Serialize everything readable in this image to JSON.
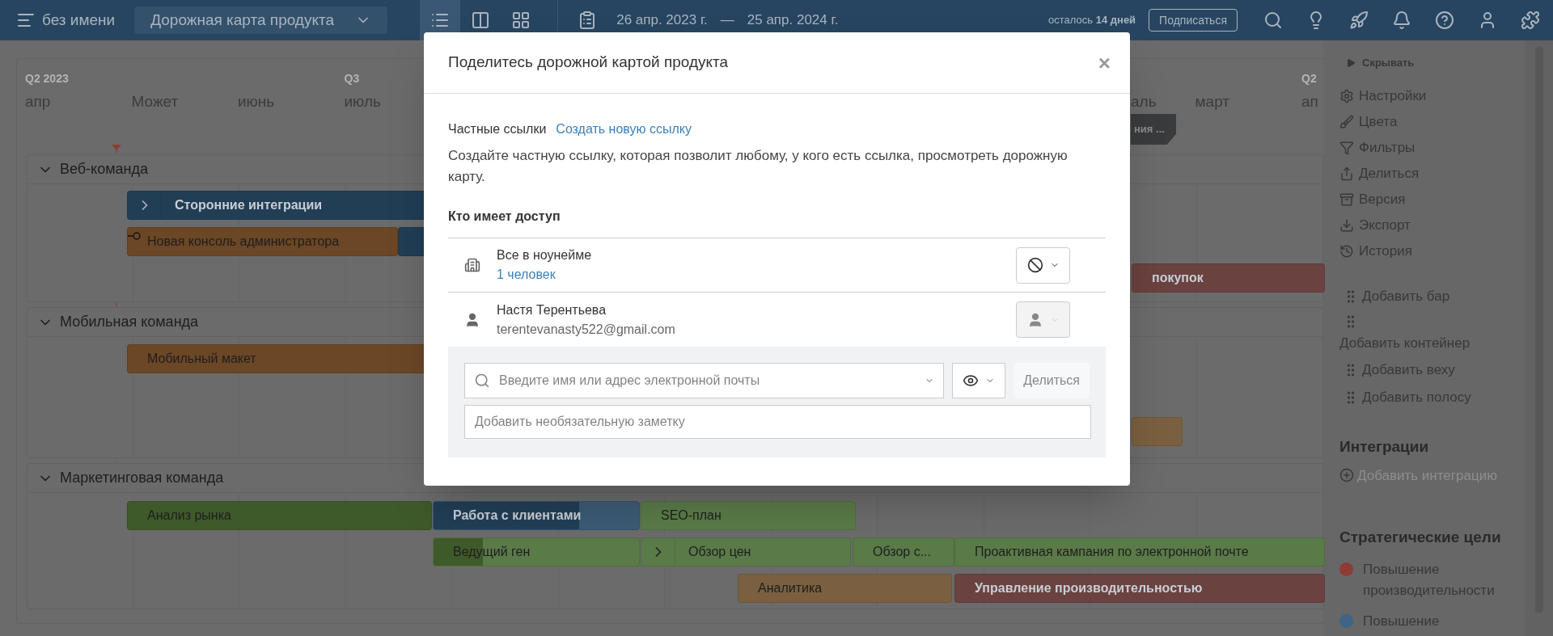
{
  "topbar": {
    "title": "без имени",
    "roadmap_select": "Дорожная карта продукта",
    "views": [
      {
        "kind": "list",
        "selected": true
      },
      {
        "kind": "columns",
        "selected": false
      },
      {
        "kind": "grid",
        "selected": false
      }
    ],
    "date_start": "26 апр. 2023 г.",
    "date_sep": "—",
    "date_end": "25 апр. 2024 г.",
    "trial": "осталось **14 дней**",
    "subscribe": "Подписаться"
  },
  "timeline": {
    "quarters": [
      "Q2 2023",
      "Q3",
      "Q2"
    ],
    "months": [
      "апр",
      "Может",
      "июнь",
      "июль",
      "аль",
      "март",
      "ап"
    ],
    "milestones": [
      {
        "label": "ния ..."
      }
    ],
    "lanes": [
      {
        "name": "Веб-команда",
        "expanded": true,
        "bars": [
          {
            "label": "Сторонние интеграции",
            "kind": "container",
            "color": "#213e55",
            "expandable": true
          },
          {
            "label": "Новая консоль администратора",
            "kind": "task",
            "color": "#6b4726",
            "links": true
          },
          {
            "kind": "container",
            "color": "#213e55"
          },
          {
            "label": "покупок",
            "kind": "container",
            "color": "#6a423f"
          }
        ]
      },
      {
        "name": "Мобильная команда",
        "expanded": true,
        "bars": [
          {
            "label": "Мобильный макет",
            "kind": "task",
            "color": "#6b4726"
          },
          {
            "kind": "task",
            "color": "#7a6040"
          }
        ]
      },
      {
        "name": "Маркетинговая команда",
        "expanded": true,
        "bars": [
          {
            "label": "Анализ рынка",
            "kind": "task",
            "color": "#3f5a2a"
          },
          {
            "label": "Работа с клиентами",
            "kind": "container",
            "color": "#3d5b75",
            "level": 0.71
          },
          {
            "label": "SEO-план",
            "kind": "task",
            "color": "#5a7a48"
          },
          {
            "label": "Ведущий ген",
            "kind": "task",
            "color": "#5a7a48",
            "level": 0.24
          },
          {
            "label": "Обзор цен",
            "kind": "task",
            "color": "#5a7a48",
            "expandable": true
          },
          {
            "label": "Обзор с...",
            "kind": "task",
            "color": "#5a7a48"
          },
          {
            "label": "Проактивная кампания по электронной почте",
            "kind": "task",
            "color": "#5a7a48"
          },
          {
            "label": "Аналитика",
            "kind": "task",
            "color": "#7a6040"
          },
          {
            "label": "Управление производительностью",
            "kind": "container",
            "color": "#6a423f"
          }
        ]
      }
    ]
  },
  "sidebar": {
    "hide": "Скрывать",
    "actions": [
      "Настройки",
      "Цвета",
      "Фильтры",
      "Делиться",
      "Версия",
      "Экспорт",
      "История"
    ],
    "add_items": [
      {
        "label": "Добавить бар",
        "kind": "inline"
      },
      {
        "label": "Добавить контейнер",
        "kind": "stacked"
      },
      {
        "label": "Добавить веху",
        "kind": "inline"
      },
      {
        "label": "Добавить полосу",
        "kind": "inline"
      }
    ],
    "integrations_title": "Интеграции",
    "add_integration": "Добавить интеграцию",
    "goals_title": "Стратегические цели",
    "goals": [
      {
        "label": "Повышение производительности",
        "color": "#8e3b36"
      },
      {
        "label": "Повышение",
        "color": "#3e6487"
      }
    ]
  },
  "modal": {
    "title": "Поделитесь дорожной картой продукта",
    "close": "×",
    "private_links": "Частные ссылки",
    "new_link": "Создать новую ссылку",
    "description": "Создайте частную ссылку, которая позволит любому, у кого есть ссылка, просмотреть дорожную карту.",
    "access_title": "Кто имеет доступ",
    "access": [
      {
        "kind": "org",
        "name": "Все в ноунейме",
        "detail": "1 человек",
        "disabled": false
      },
      {
        "kind": "person",
        "name": "Настя Терентьева",
        "detail": "terentevanasty522@gmail.com",
        "disabled": true
      }
    ],
    "invite_placeholder": "Введите имя или адрес электронной почты",
    "share": "Делиться",
    "note_placeholder": "Добавить необязательную заметку"
  }
}
